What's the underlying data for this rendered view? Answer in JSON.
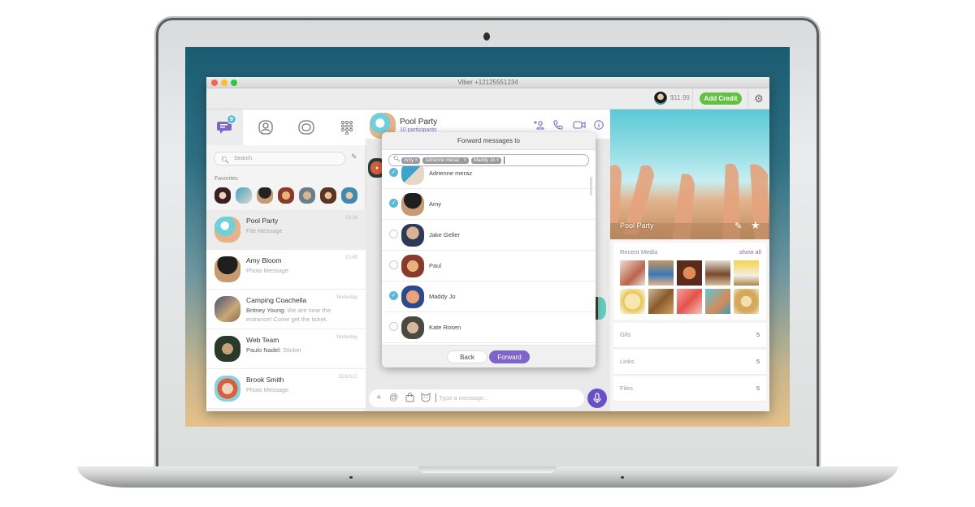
{
  "window": {
    "title": "Viber  +12125551234",
    "traffic_lights": [
      "#fc5f57",
      "#fdbc2e",
      "#28c840"
    ]
  },
  "toolbar": {
    "balance": "$11.99",
    "add_credit_label": "Add Credit",
    "settings_icon": "gear-icon",
    "accent_green": "#62c143"
  },
  "sidebar": {
    "tabs": [
      {
        "name": "chats",
        "icon": "chat-bubble-icon",
        "badge": "9",
        "active": true
      },
      {
        "name": "contacts",
        "icon": "contact-icon"
      },
      {
        "name": "public-accounts",
        "icon": "public-chats-icon"
      },
      {
        "name": "more",
        "icon": "dialpad-icon"
      }
    ],
    "search_placeholder": "Search",
    "favorites_label": "Favorites",
    "favorites_count": 7,
    "chats": [
      {
        "name": "Pool Party",
        "sender": "",
        "message": "File Message",
        "time": "15:16",
        "selected": true
      },
      {
        "name": "Amy Bloom",
        "sender": "",
        "message": "Photo Message",
        "time": "10:45"
      },
      {
        "name": "Camping Coachella",
        "sender": "Britney Young:",
        "message": "We are near the entrance! Come get the ticket.",
        "time": "Yesterday"
      },
      {
        "name": "Web Team",
        "sender": "Paulo Nadel:",
        "message": "Sticker",
        "time": "Yesterday"
      },
      {
        "name": "Brook Smith",
        "sender": "",
        "message": "Photo Message",
        "time": "31/10/17"
      }
    ]
  },
  "conversation": {
    "title": "Pool Party",
    "subtitle": "10 participants",
    "composer_placeholder": "Type a message...",
    "accent": "#7f65c9"
  },
  "forward_dialog": {
    "title": "Forward messages to",
    "chips": [
      "Amy",
      "Adrienne meraz",
      "Maddy Jo"
    ],
    "contacts": [
      {
        "name": "Adrienne meraz",
        "checked": true
      },
      {
        "name": "Amy",
        "checked": true
      },
      {
        "name": "Jake Geller",
        "checked": false
      },
      {
        "name": "Paul",
        "checked": false
      },
      {
        "name": "Maddy Jo",
        "checked": true
      },
      {
        "name": "Kate Rosen",
        "checked": false
      }
    ],
    "back_label": "Back",
    "forward_label": "Forward"
  },
  "info_panel": {
    "group_name": "Pool Party",
    "recent_media_label": "Recent Media",
    "show_all_label": "show all",
    "media_count": 10,
    "stats": [
      {
        "label": "Gifs",
        "value": "5"
      },
      {
        "label": "Links",
        "value": "5"
      },
      {
        "label": "Files",
        "value": "5"
      }
    ]
  }
}
